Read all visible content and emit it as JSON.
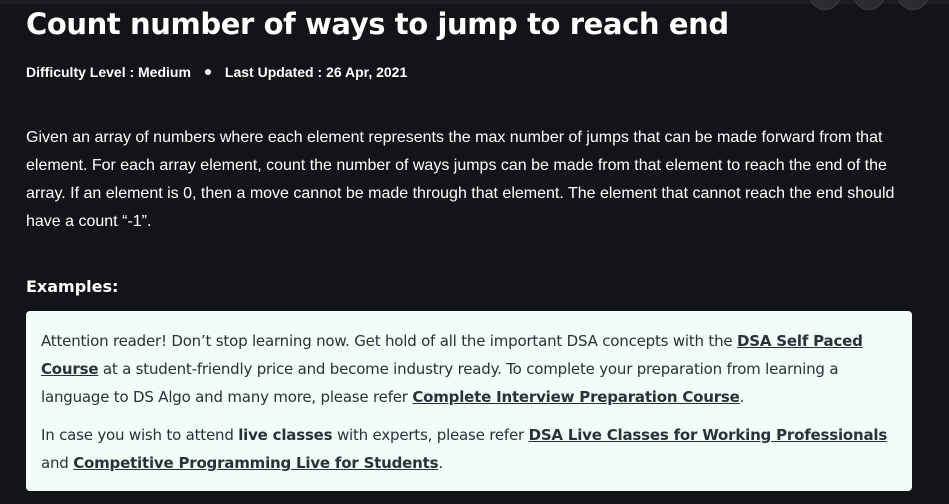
{
  "article": {
    "title": "Count number of ways to jump to reach end",
    "difficulty": "Difficulty Level : Medium",
    "last_updated": "Last Updated : 26 Apr, 2021",
    "description": "Given an array of numbers where each element represents the max number of jumps that can be made forward from that element. For each array element, count the number of ways jumps can be made from that element to reach the end of the array. If an element is 0, then a move cannot be made through that element. The element that cannot reach the end should have a count “-1”.",
    "examples_heading": "Examples:"
  },
  "notice": {
    "p1_text1": "Attention reader! Don’t stop learning now. Get hold of all the important DSA concepts with the ",
    "p1_link1": "DSA Self Paced Course",
    "p1_text2": " at a student-friendly price and become industry ready.  To complete your preparation from learning a language to DS Algo and many more,  please refer ",
    "p1_link2": "Complete Interview Preparation Course",
    "p1_text3": ".",
    "p2_text1": "In case you wish to attend ",
    "p2_bold": "live classes",
    "p2_text2": " with experts, please refer ",
    "p2_link1": "DSA Live Classes for Working Professionals",
    "p2_text3": " and ",
    "p2_link2": "Competitive Programming Live for Students",
    "p2_text4": "."
  },
  "colors": {
    "page_background": "#131417",
    "notice_background": "#f3fcf6",
    "notice_text": "#273239"
  }
}
